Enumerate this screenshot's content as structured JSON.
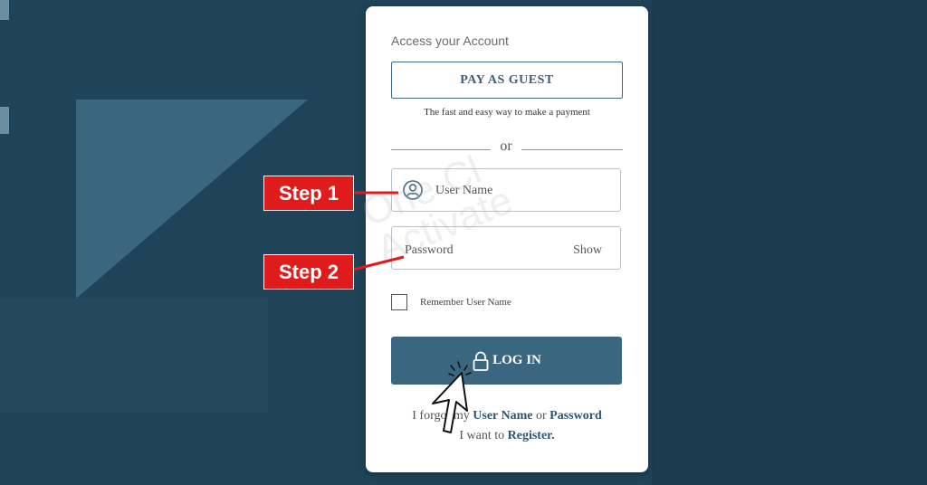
{
  "login": {
    "heading": "Access your Account",
    "guest_button": "PAY AS GUEST",
    "tagline": "The fast and easy way to make a payment",
    "or_text": "or",
    "username_placeholder": "User Name",
    "password_placeholder": "Password",
    "show_label": "Show",
    "remember_label": "Remember User Name",
    "login_button": "LOG IN",
    "forgot_prefix": "I forgot my",
    "forgot_username": "User Name",
    "forgot_or": "or",
    "forgot_password": "Password",
    "register_prefix": "I want to",
    "register_link": "Register."
  },
  "steps": {
    "step1": "Step 1",
    "step2": "Step 2"
  },
  "watermark": {
    "line1": "One Cl",
    "line2": "Activate"
  },
  "colors": {
    "background": "#1f4358",
    "accent": "#3b6680",
    "step_red": "#e01b1b"
  }
}
